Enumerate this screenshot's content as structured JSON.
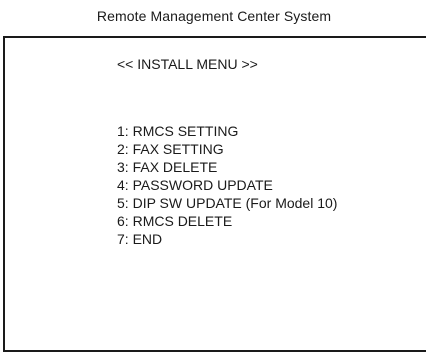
{
  "title": "Remote Management Center System",
  "screen": {
    "header": "<< INSTALL MENU >>",
    "items": [
      {
        "key": "1:",
        "label": "RMCS SETTING",
        "note": ""
      },
      {
        "key": "2:",
        "label": "FAX SETTING",
        "note": ""
      },
      {
        "key": "3:",
        "label": "FAX DELETE",
        "note": ""
      },
      {
        "key": "4:",
        "label": "PASSWORD UPDATE",
        "note": ""
      },
      {
        "key": "5:",
        "label": "DIP SW UPDATE",
        "note": "(For Model 10)"
      },
      {
        "key": "6:",
        "label": "RMCS DELETE",
        "note": ""
      },
      {
        "key": "7:",
        "label": "END",
        "note": ""
      }
    ]
  }
}
